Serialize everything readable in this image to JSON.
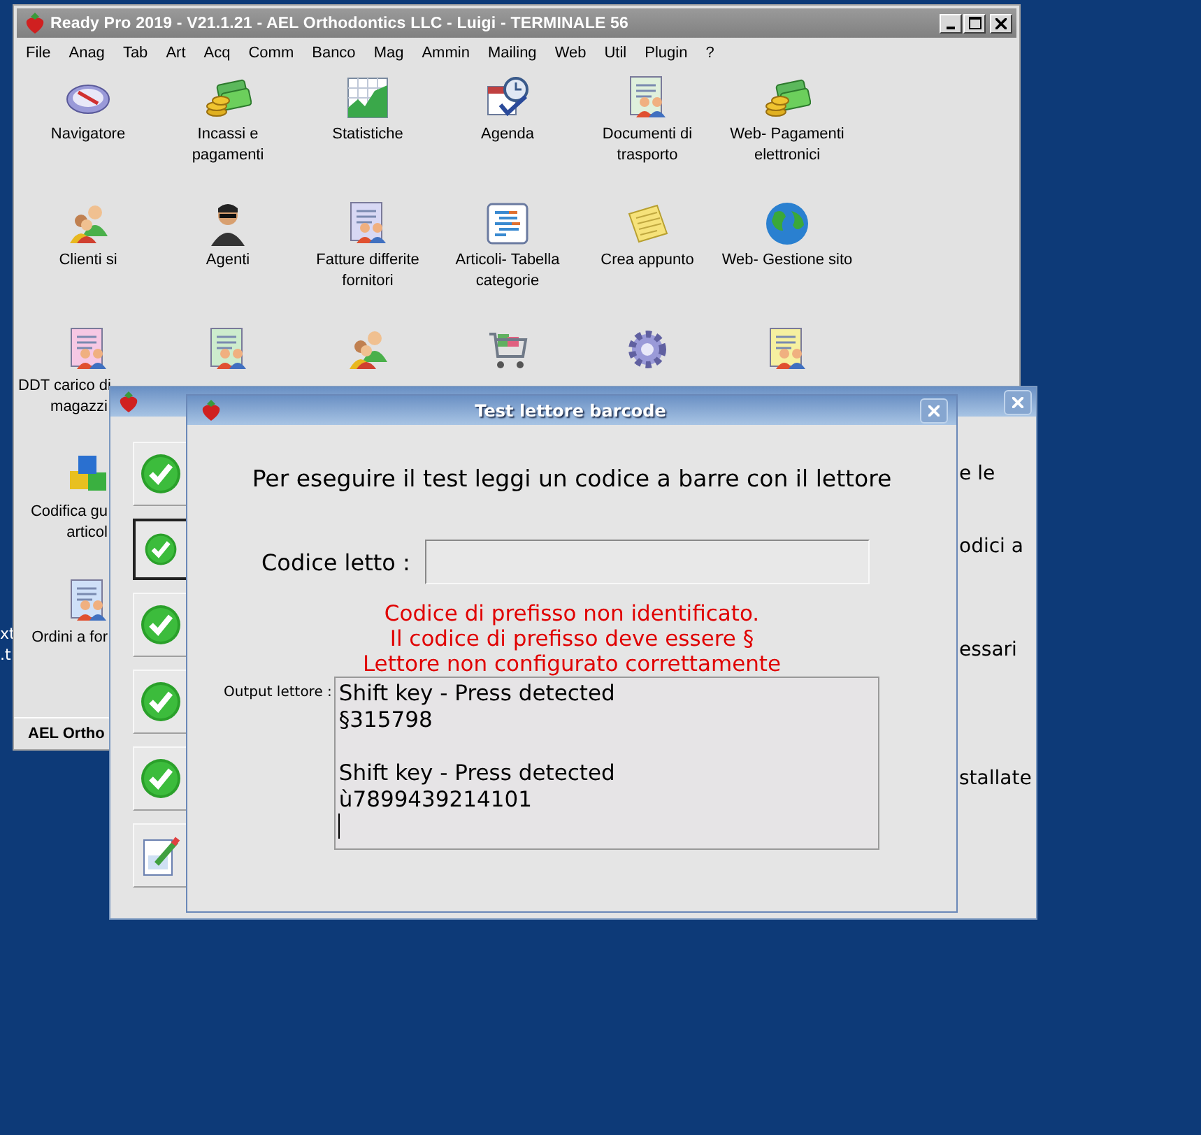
{
  "desktop_labels": [
    "xt",
    ".t"
  ],
  "main_window": {
    "title": "Ready Pro 2019 - V21.1.21 - AEL Orthodontics LLC - Luigi - TERMINALE 56",
    "menu": [
      "File",
      "Anag",
      "Tab",
      "Art",
      "Acq",
      "Comm",
      "Banco",
      "Mag",
      "Ammin",
      "Mailing",
      "Web",
      "Util",
      "Plugin",
      "?"
    ],
    "shortcut_rows": [
      [
        {
          "lines": [
            "Navigatore"
          ]
        },
        {
          "lines": [
            "Incassi e",
            "pagamenti"
          ]
        },
        {
          "lines": [
            "Statistiche"
          ]
        },
        {
          "lines": [
            "Agenda"
          ]
        },
        {
          "lines": [
            "Documenti di",
            "trasporto"
          ]
        },
        {
          "lines": [
            "Web- Pagamenti",
            "elettronici"
          ]
        }
      ],
      [
        {
          "lines": [
            "Clienti si"
          ]
        },
        {
          "lines": [
            "Agenti"
          ]
        },
        {
          "lines": [
            "Fatture differite",
            "fornitori"
          ]
        },
        {
          "lines": [
            "Articoli- Tabella",
            "categorie"
          ]
        },
        {
          "lines": [
            "Crea appunto"
          ]
        },
        {
          "lines": [
            "Web- Gestione sito"
          ]
        }
      ],
      [
        {
          "lines": [
            "DDT carico di",
            "magazzi"
          ]
        }
      ],
      [
        {
          "lines": [
            "Codifica gu",
            "articol"
          ]
        }
      ],
      [
        {
          "lines": [
            "Ordini a for"
          ]
        }
      ]
    ],
    "status_bar": "AEL Ortho"
  },
  "setup_window": {
    "steps": [
      {
        "kind": "check",
        "selected": false
      },
      {
        "kind": "check",
        "selected": true
      },
      {
        "kind": "check",
        "selected": false
      },
      {
        "kind": "check",
        "selected": false
      },
      {
        "kind": "check",
        "selected": false
      },
      {
        "kind": "edit",
        "selected": false
      }
    ],
    "side_texts": [
      "e le",
      "odici a",
      "essari",
      "stallate"
    ]
  },
  "dialog": {
    "title": "Test lettore barcode",
    "instruction": "Per eseguire il test leggi un codice a barre con il lettore",
    "code_label": "Codice letto :",
    "messages": [
      "Codice di prefisso non identificato.",
      "Il codice di prefisso deve essere §",
      "Lettore non configurato correttamente"
    ],
    "output_label": "Output lettore :",
    "output_blocks": [
      [
        "Shift key - Press detected",
        "§315798"
      ],
      [
        "Shift key - Press detected",
        "ù7899439214101"
      ]
    ]
  }
}
